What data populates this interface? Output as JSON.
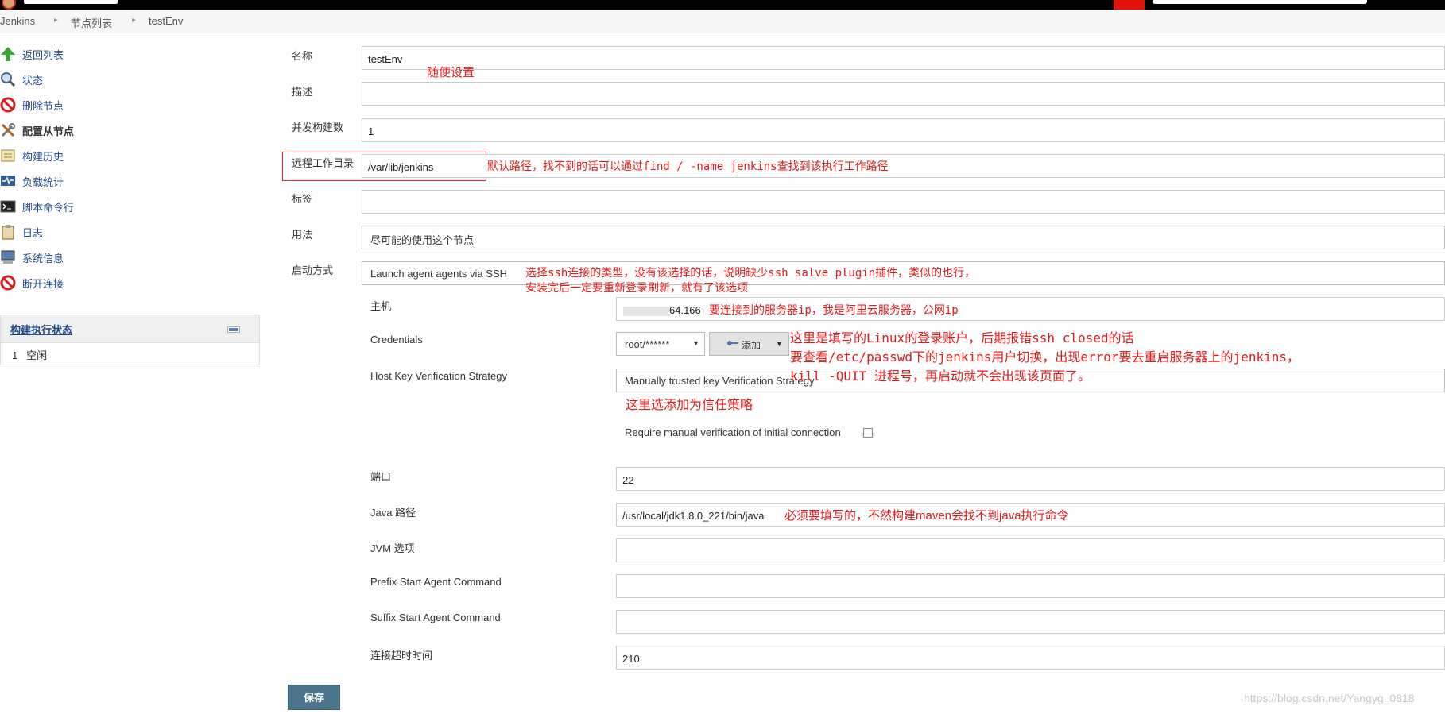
{
  "breadcrumb": [
    "Jenkins",
    "节点列表",
    "testEnv"
  ],
  "sidebar": {
    "items": [
      {
        "label": "返回列表",
        "icon": "up-arrow-icon"
      },
      {
        "label": "状态",
        "icon": "magnifier-icon"
      },
      {
        "label": "删除节点",
        "icon": "no-entry-icon"
      },
      {
        "label": "配置从节点",
        "icon": "tools-icon"
      },
      {
        "label": "构建历史",
        "icon": "notepad-icon"
      },
      {
        "label": "负载统计",
        "icon": "monitor-graph-icon"
      },
      {
        "label": "脚本命令行",
        "icon": "terminal-icon"
      },
      {
        "label": "日志",
        "icon": "clipboard-icon"
      },
      {
        "label": "系统信息",
        "icon": "computer-icon"
      },
      {
        "label": "断开连接",
        "icon": "no-entry-icon"
      }
    ]
  },
  "executor": {
    "title": "构建执行状态",
    "row_num": "1",
    "row_status": "空闲"
  },
  "form": {
    "name_label": "名称",
    "name_value": "testEnv",
    "desc_label": "描述",
    "executors_label": "并发构建数",
    "executors_value": "1",
    "remote_dir_label": "远程工作目录",
    "remote_dir_value": "/var/lib/jenkins",
    "labels_label": "标签",
    "usage_label": "用法",
    "usage_value": "尽可能的使用这个节点",
    "launch_label": "启动方式",
    "launch_value": "Launch agent agents via SSH",
    "host_label": "主机",
    "host_value": "64.166",
    "cred_label": "Credentials",
    "cred_value": "root/******",
    "add_label": "添加",
    "hkvs_label": "Host Key Verification Strategy",
    "hkvs_value": "Manually trusted key Verification Strategy",
    "require_label": "Require manual verification of initial connection",
    "port_label": "端口",
    "port_value": "22",
    "java_label": "Java 路径",
    "java_value": "/usr/local/jdk1.8.0_221/bin/java",
    "jvm_label": "JVM 选项",
    "prefix_label": "Prefix Start Agent Command",
    "suffix_label": "Suffix Start Agent Command",
    "timeout_label": "连接超时时间",
    "timeout_value": "210",
    "save_label": "保存"
  },
  "notes": {
    "n1": "随便设置",
    "n2": "默认路径，找不到的话可以通过find / -name jenkins查找到该执行工作路径",
    "n3a": "选择ssh连接的类型，没有该选择的话，说明缺少ssh salve plugin插件，类似的也行，",
    "n3b": "安装完后一定要重新登录刷新，就有了该选项",
    "n4": "要连接到的服务器ip，我是阿里云服务器，公网ip",
    "n5a": "这里是填写的Linux的登录账户，后期报错ssh closed的话",
    "n5b": "要查看/etc/passwd下的jenkins用户切换，出现error要去重启服务器上的jenkins，",
    "n5c": "kill -QUIT 进程号，再启动就不会出现该页面了。",
    "n6": "这里选添加为信任策略",
    "n7": "必须要填写的，不然构建maven会找不到java执行命令"
  },
  "watermark": "https://blog.csdn.net/Yangyg_0818",
  "colors": {
    "annotation": "#e01b1b",
    "save_button": "#4b758b",
    "link": "#204a87"
  }
}
